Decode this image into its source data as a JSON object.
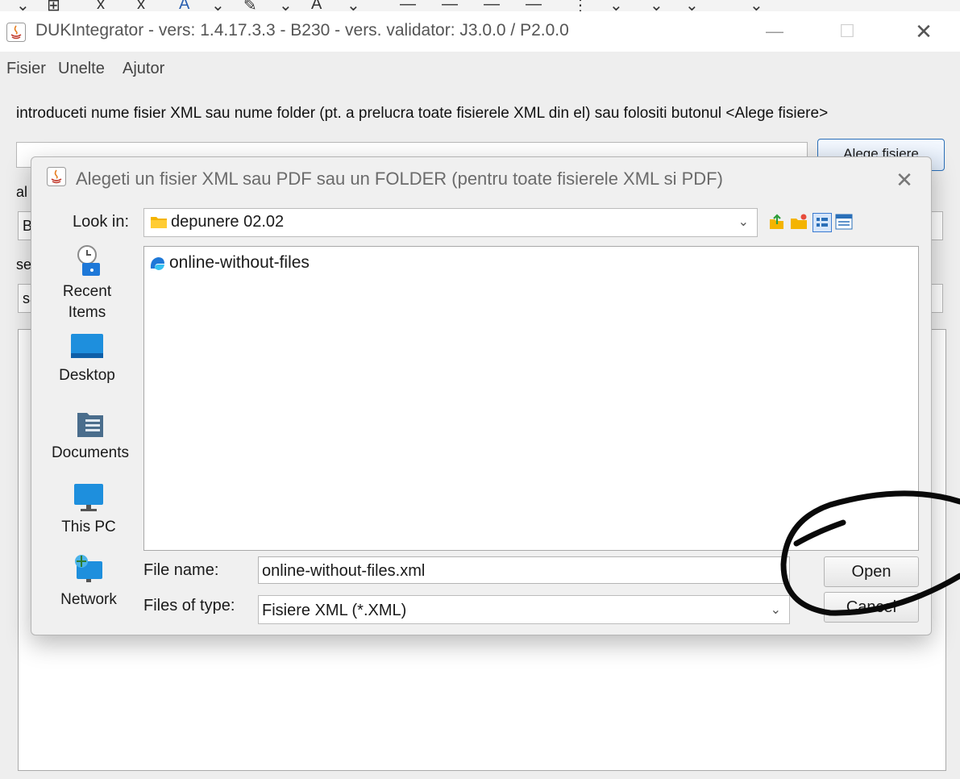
{
  "app": {
    "title": "DUKIntegrator - vers: 1.4.17.3.3 - B230 - vers. validator: J3.0.0 / P2.0.0",
    "window_controls": {
      "minimize": "—",
      "maximize": "☐",
      "close": "✕"
    }
  },
  "menu": [
    "Fisier",
    "Unelte",
    "Ajutor"
  ],
  "main": {
    "instruction": "introduceti nume fisier XML sau nume folder (pt. a prelucra toate fisierele XML din el) sau folositi butonul <Alege fisiere>",
    "path_value": "",
    "choose_button": "Alege fisiere",
    "partial_labels": [
      "al",
      "B",
      "se",
      "sa"
    ]
  },
  "dialog": {
    "title": "Alegeti un fisier XML sau PDF sau un FOLDER (pentru toate fisierele XML si PDF)",
    "close": "✕",
    "look_in_label": "Look in:",
    "look_in_value": "depunere 02.02",
    "toolbar_icons": [
      "up-folder-icon",
      "new-folder-icon",
      "list-view-icon",
      "details-view-icon"
    ],
    "places": [
      {
        "label": "Recent Items",
        "icon": "recent-items-icon"
      },
      {
        "label": "Desktop",
        "icon": "desktop-icon"
      },
      {
        "label": "Documents",
        "icon": "documents-icon"
      },
      {
        "label": "This PC",
        "icon": "this-pc-icon"
      },
      {
        "label": "Network",
        "icon": "network-icon"
      }
    ],
    "files": [
      {
        "name": "online-without-files",
        "icon": "edge-file-icon"
      }
    ],
    "file_name_label": "File name:",
    "file_name_value": "online-without-files.xml",
    "files_of_type_label": "Files of type:",
    "files_of_type_value": "Fisiere XML (*.XML)",
    "open_button": "Open",
    "cancel_button": "Cancel"
  },
  "colors": {
    "accent": "#2a6fb8",
    "folder": "#f4b400",
    "dialog_bg": "#f0f0f0",
    "annotation": "#000000"
  }
}
